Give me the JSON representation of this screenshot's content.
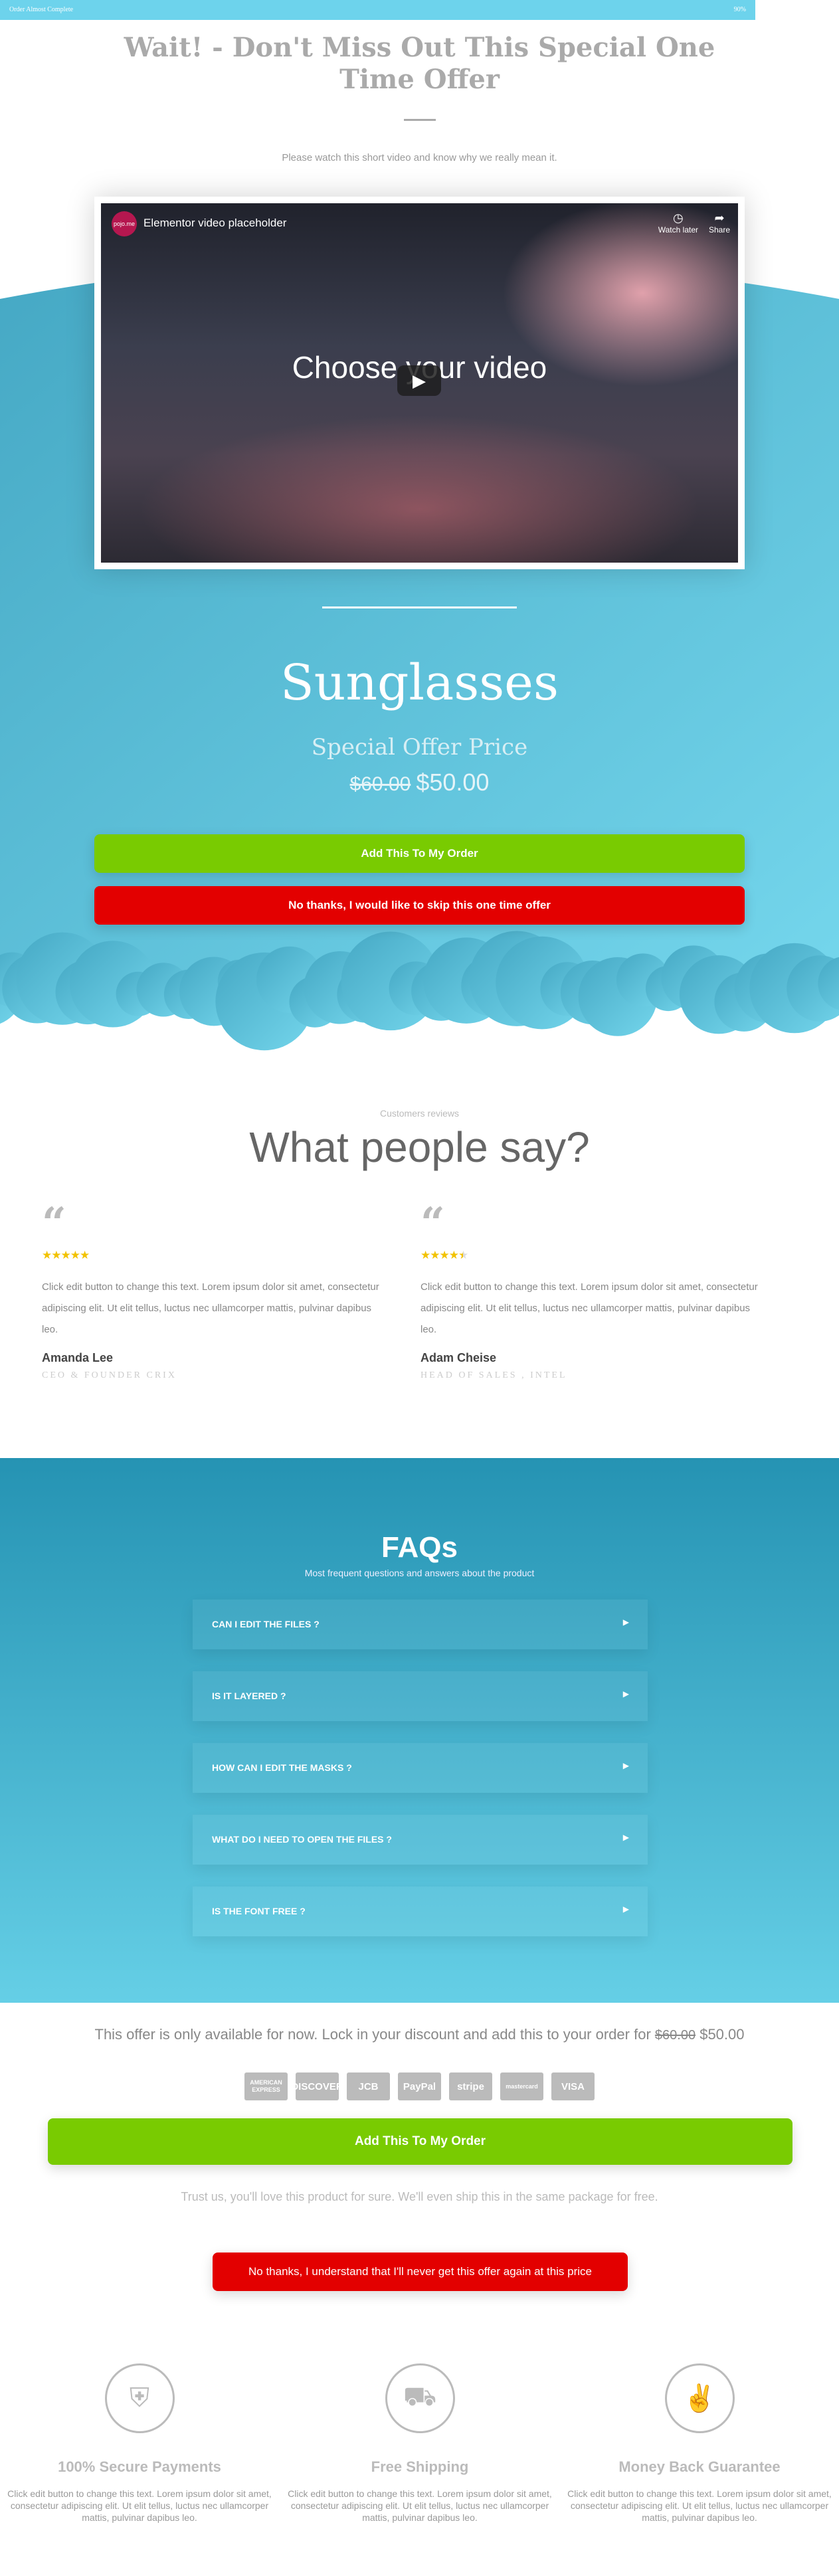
{
  "progress": {
    "label": "Order Almost Complete",
    "percent_text": "90%",
    "value": 90
  },
  "header": {
    "title": "Wait! - Don't Miss Out This Special One Time Offer",
    "subtitle": "Please watch this short video and know why we really mean it."
  },
  "video": {
    "channel_logo": "pojo.me",
    "title": "Elementor video placeholder",
    "watch_later": "Watch later",
    "share": "Share",
    "overlay_text": "Choose your video"
  },
  "product": {
    "name": "Sunglasses",
    "offer_label": "Special Offer Price",
    "old_price": "$60.00",
    "new_price": "$50.00",
    "add_button": "Add This To My Order",
    "skip_button": "No thanks, I would like to skip this one time offer"
  },
  "reviews": {
    "kicker": "Customers reviews",
    "title": "What people say?",
    "items": [
      {
        "rating": 5,
        "text": "Click edit button to change this text. Lorem ipsum dolor sit amet, consectetur adipiscing elit. Ut elit tellus, luctus nec ullamcorper mattis, pulvinar dapibus leo.",
        "name": "Amanda Lee",
        "role": "CEO & FOUNDER CRIX"
      },
      {
        "rating": 4.5,
        "text": "Click edit button to change this text. Lorem ipsum dolor sit amet, consectetur adipiscing elit. Ut elit tellus, luctus nec ullamcorper mattis, pulvinar dapibus leo.",
        "name": "Adam Cheise",
        "role": "HEAD OF SALES , INTEL"
      }
    ]
  },
  "faq": {
    "title": "FAQs",
    "subtitle": "Most frequent questions and answers about the product",
    "items": [
      "CAN I EDIT THE FILES ?",
      "IS IT LAYERED ?",
      "HOW CAN I EDIT THE MASKS ?",
      "WHAT DO I NEED TO OPEN THE FILES ?",
      "IS THE FONT FREE ?"
    ]
  },
  "closing": {
    "offer_text": "This offer is only available for now. Lock in your discount and add this to your order for",
    "old_price": "$60.00",
    "new_price": "$50.00",
    "cards": [
      "AMERICAN EXPRESS",
      "DISCOVER",
      "JCB",
      "PayPal",
      "stripe",
      "mastercard",
      "VISA"
    ],
    "add_button": "Add This To My Order",
    "trust_text": "Trust us, you'll love this product for sure. We'll even ship this in the same package for free.",
    "skip_button": "No thanks, I understand that I'll never get this offer again at this price"
  },
  "features": [
    {
      "icon": "shield-icon",
      "title": "100% Secure Payments",
      "text": "Click edit button to change this text. Lorem ipsum dolor sit amet, consectetur adipiscing elit. Ut elit tellus, luctus nec ullamcorper mattis, pulvinar dapibus leo."
    },
    {
      "icon": "truck-icon",
      "title": "Free Shipping",
      "text": "Click edit button to change this text. Lorem ipsum dolor sit amet, consectetur adipiscing elit. Ut elit tellus, luctus nec ullamcorper mattis, pulvinar dapibus leo."
    },
    {
      "icon": "hand-peace-icon",
      "title": "Money Back Guarantee",
      "text": "Click edit button to change this text. Lorem ipsum dolor sit amet, consectetur adipiscing elit. Ut elit tellus, luctus nec ullamcorper mattis, pulvinar dapibus leo."
    }
  ],
  "colors": {
    "progress": "#6dd3ec",
    "accent_green": "#79cb01",
    "accent_red": "#e30000",
    "blue_dark": "#2593b3",
    "blue_light": "#6fd3ea",
    "stars": "#f2c200"
  }
}
